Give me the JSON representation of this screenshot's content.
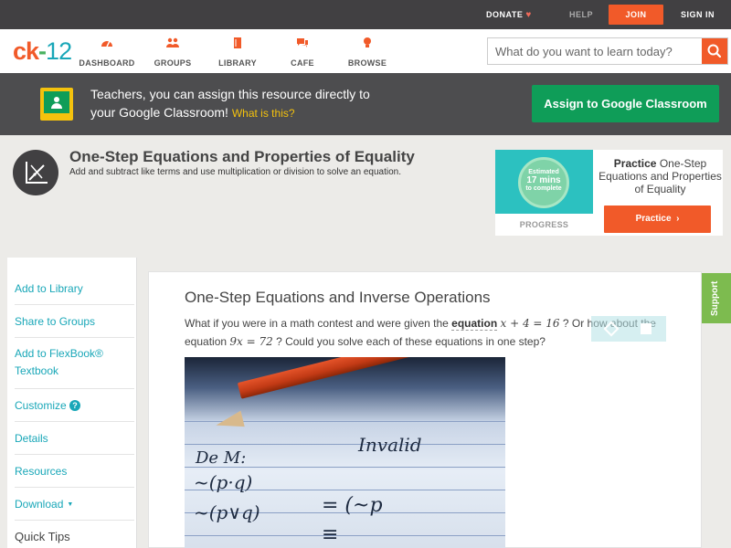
{
  "topbar": {
    "donate": "DONATE",
    "help": "HELP",
    "join": "JOIN",
    "signin": "SIGN IN"
  },
  "header": {
    "logo_ck": "ck",
    "logo_dash": "-",
    "logo_num": "12",
    "nav": [
      {
        "label": "DASHBOARD",
        "icon": "dashboard-icon"
      },
      {
        "label": "GROUPS",
        "icon": "groups-icon"
      },
      {
        "label": "LIBRARY",
        "icon": "library-icon"
      },
      {
        "label": "CAFE",
        "icon": "cafe-icon"
      },
      {
        "label": "BROWSE",
        "icon": "browse-icon"
      }
    ],
    "search_placeholder": "What do you want to learn today?"
  },
  "teacher_banner": {
    "line1": "Teachers, you can assign this resource directly to",
    "line2": "your Google Classroom!",
    "what_link": "What is this?",
    "assign_button": "Assign to Google Classroom"
  },
  "concept": {
    "title": "One-Step Equations and Properties of Equality",
    "subtitle": "Add and subtract like terms and use multiplication or division to solve an equation."
  },
  "practice_card": {
    "estimated": "Estimated",
    "mins": "17 mins",
    "to_complete": "to complete",
    "progress_label": "PROGRESS",
    "practice_word": "Practice",
    "practice_topic": "One-Step Equations and Properties of Equality",
    "practice_button": "Practice"
  },
  "sidebar": {
    "items": [
      "Add to Library",
      "Share to Groups",
      "Add to FlexBook® Textbook",
      "Customize",
      "Details",
      "Resources",
      "Download"
    ],
    "quick_tips": "Quick Tips"
  },
  "lesson": {
    "title": "One-Step Equations and Inverse Operations",
    "p_part1": "What if you were in a math contest and were given the ",
    "p_term": "equation",
    "p_eq1": "x + 4 = 16",
    "p_part2": " ? Or how about the equation ",
    "p_eq2": "9x = 72",
    "p_part3": " ? Could you solve each of these equations in one step?"
  },
  "support_tab": "Support",
  "colors": {
    "brand_orange": "#f15a29",
    "brand_teal": "#19a7b8",
    "google_green": "#0f9d58",
    "support_green": "#7dbb4f"
  }
}
